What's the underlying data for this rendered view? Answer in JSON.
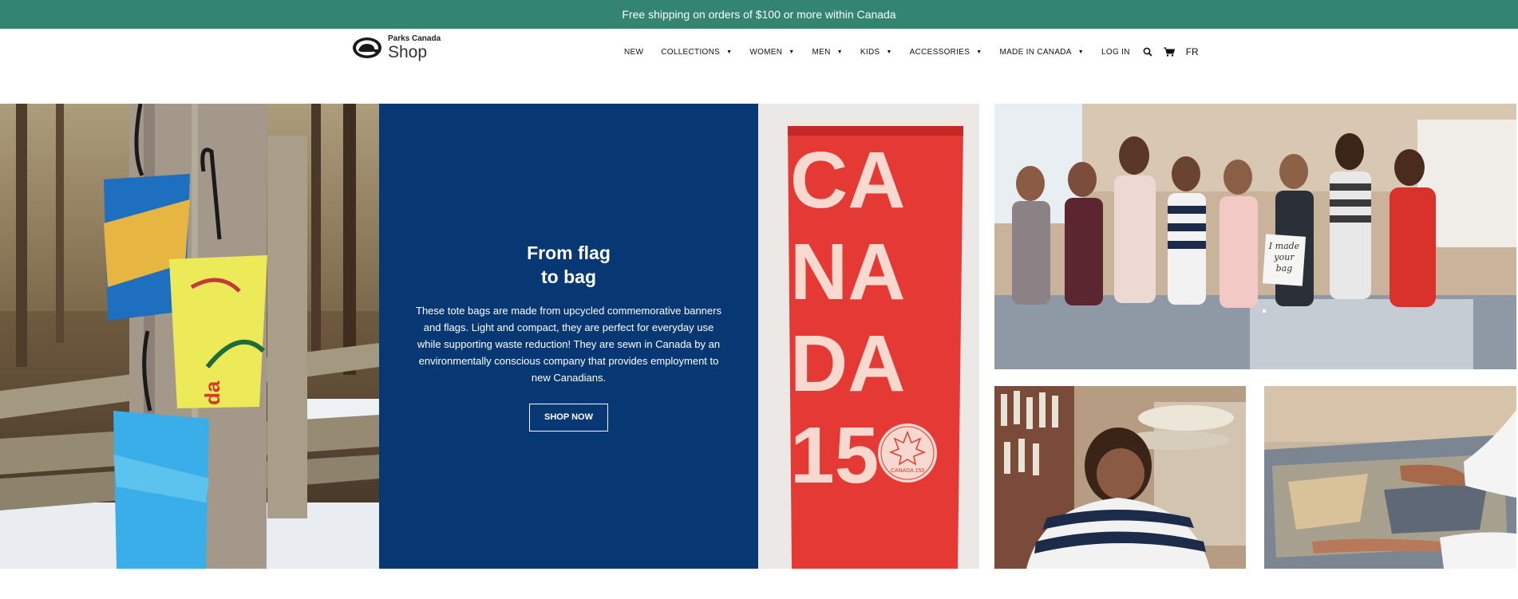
{
  "announcement": "Free shipping on orders of $100 or more within Canada",
  "logo": {
    "brand": "Parks Canada",
    "shop": "Shop"
  },
  "nav": {
    "items": [
      {
        "label": "NEW",
        "dropdown": false
      },
      {
        "label": "COLLECTIONS",
        "dropdown": true
      },
      {
        "label": "WOMEN",
        "dropdown": true
      },
      {
        "label": "MEN",
        "dropdown": true
      },
      {
        "label": "KIDS",
        "dropdown": true
      },
      {
        "label": "ACCESSORIES",
        "dropdown": true
      },
      {
        "label": "MADE IN CANADA",
        "dropdown": true
      },
      {
        "label": "LOG IN",
        "dropdown": false
      }
    ],
    "caret": "▼",
    "icons": [
      "search-icon",
      "cart-icon"
    ],
    "language": "FR"
  },
  "hero": {
    "title": "From flag\nto bag",
    "body": "These tote bags are made from upcycled commemorative banners and flags. Light and compact, they are perfect for everyday use while supporting waste reduction! They are sewn in Canada by an environmentally conscious company that provides employment to new Canadians.",
    "cta": "SHOP NOW",
    "flag": {
      "lines": [
        "CA",
        "NA",
        "DA",
        "15"
      ],
      "digit": "0",
      "emblem_text": "CANADA 150"
    },
    "sign_text": [
      "I made",
      "your",
      "bag"
    ],
    "tote_text": "da"
  },
  "colors": {
    "announcement_bg": "#338470",
    "promo_bg": "#073873",
    "flag_red": "#e53935"
  }
}
